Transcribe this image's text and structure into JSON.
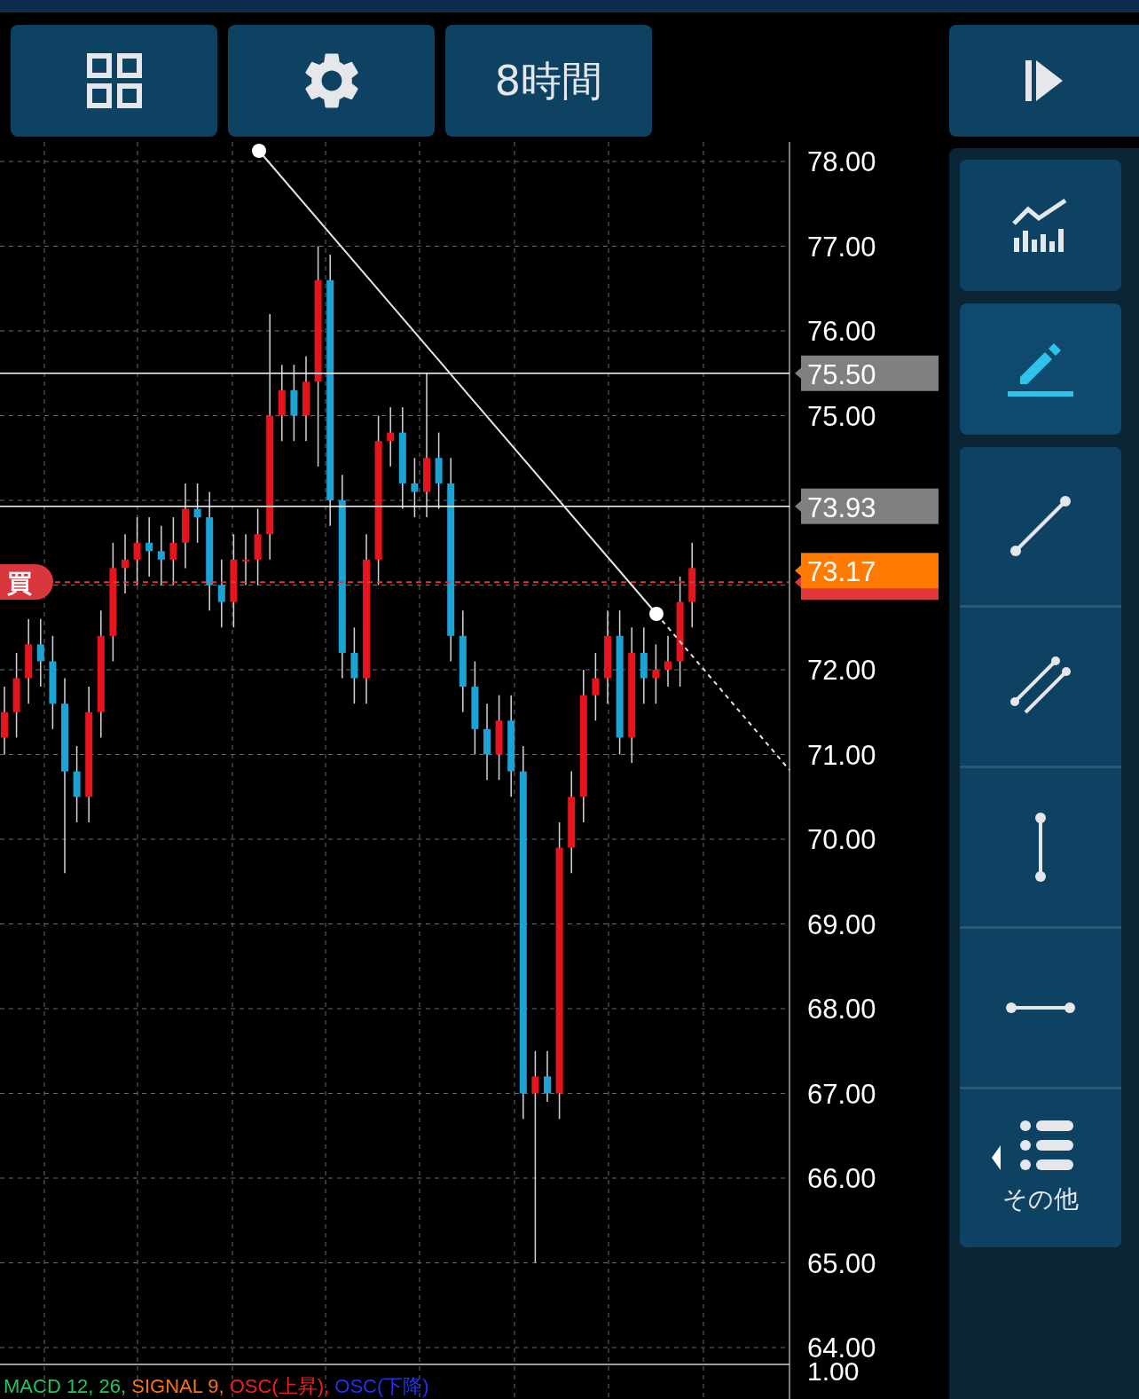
{
  "toolbar": {
    "buttons": [
      {
        "kind": "layout"
      },
      {
        "kind": "settings"
      },
      {
        "kind": "timeframe",
        "label": "8時間"
      }
    ],
    "play_button": {
      "kind": "step"
    }
  },
  "sidebar": {
    "tools": [
      {
        "kind": "indicator",
        "selected": false
      },
      {
        "kind": "draw",
        "selected": true
      }
    ],
    "line_tools": [
      {
        "kind": "trendline"
      },
      {
        "kind": "channel"
      },
      {
        "kind": "vertical"
      },
      {
        "kind": "horizontal"
      },
      {
        "kind": "more",
        "label": "その他"
      }
    ]
  },
  "chart": {
    "price_axis": {
      "labels": [
        "78.00",
        "77.00",
        "76.00",
        "75.00",
        "72.00",
        "71.00",
        "70.00",
        "69.00",
        "68.00",
        "67.00",
        "66.00",
        "65.00",
        "64.00"
      ]
    },
    "price_tags": [
      {
        "kind": "line",
        "label": "75.50",
        "color": "#808080"
      },
      {
        "kind": "line",
        "label": "73.93",
        "color": "#808080"
      },
      {
        "kind": "position",
        "color": "#e0363c"
      },
      {
        "kind": "current",
        "label": "73.17",
        "color": "#ff7a00"
      }
    ],
    "position_marker": {
      "label": "買"
    },
    "indicator_axis": {
      "label": "1.00"
    },
    "legend": [
      {
        "label": "MACD 12, 26,",
        "color": "#22c55e"
      },
      {
        "label": "SIGNAL 9,",
        "color": "#f97316"
      },
      {
        "label": "OSC(上昇),",
        "color": "#ef2020"
      },
      {
        "label": "OSC(下降)",
        "color": "#2233ee"
      }
    ]
  }
}
